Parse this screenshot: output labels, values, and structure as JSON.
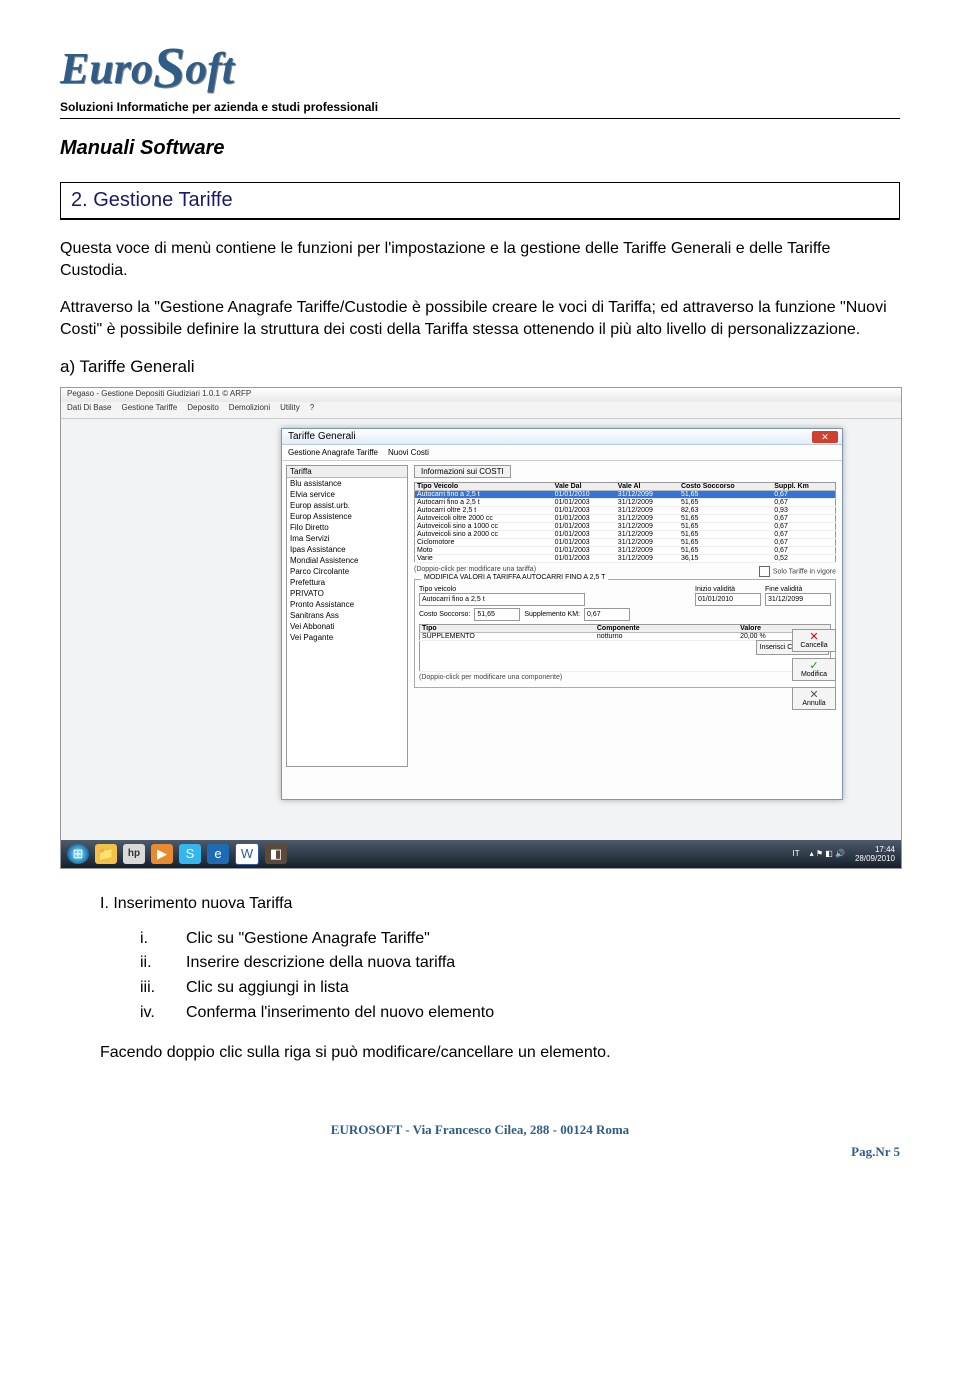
{
  "logo": {
    "part1": "Euro",
    "part2": "S",
    "part3": "oft"
  },
  "tagline": "Soluzioni Informatiche per azienda e studi professionali",
  "manual_title": "Manuali Software",
  "section_title": "2. Gestione Tariffe",
  "intro_p1": "Questa voce di menù contiene le funzioni per l'impostazione e la gestione delle Tariffe Generali e delle Tariffe Custodia.",
  "intro_p2": "Attraverso la \"Gestione Anagrafe Tariffe/Custodie è possibile creare le voci di Tariffa; ed attraverso la funzione \"Nuovi Costi\" è possibile definire la struttura dei costi della Tariffa stessa ottenendo il più alto livello di personalizzazione.",
  "subhead_a": "a) Tariffe Generali",
  "app": {
    "title": "Pegaso - Gestione Depositi Giudiziari 1.0.1 © ARFP",
    "menu": [
      "Dati Di Base",
      "Gestione Tariffe",
      "Deposito",
      "Demolizioni",
      "Utility",
      "?"
    ]
  },
  "dialog": {
    "title": "Tariffe Generali",
    "tabs": [
      "Gestione Anagrafe Tariffe",
      "Nuovi Costi"
    ],
    "list_header": "Tariffa",
    "tariffe": [
      "Blu assistance",
      "Elvia service",
      "Europ assist.urb.",
      "Europ Assistence",
      "Filo Diretto",
      "Ima Servizi",
      "Ipas Assistance",
      "Mondial Assistence",
      "Parco Circolante",
      "Prefettura",
      "PRIVATO",
      "Pronto Assistance",
      "Sanitrans Ass",
      "Vei Abbonati",
      "Vei Pagante"
    ],
    "info_btn": "Informazioni sui COSTI",
    "columns": [
      "Tipo Veicolo",
      "Vale Dal",
      "Vale Al",
      "Costo Soccorso",
      "Suppl. Km"
    ],
    "rows": [
      {
        "tv": "Autocarri fino a 2,5 t",
        "dal": "01/01/2010",
        "al": "31/12/2099",
        "cs": "51,65",
        "sk": "0,67",
        "sel": true
      },
      {
        "tv": "Autocarri fino a 2,5 t",
        "dal": "01/01/2003",
        "al": "31/12/2009",
        "cs": "51,65",
        "sk": "0,67"
      },
      {
        "tv": "Autocarri oltre 2,5 t",
        "dal": "01/01/2003",
        "al": "31/12/2009",
        "cs": "82,63",
        "sk": "0,93"
      },
      {
        "tv": "Autoveicoli oltre 2000 cc",
        "dal": "01/01/2003",
        "al": "31/12/2009",
        "cs": "51,65",
        "sk": "0,67"
      },
      {
        "tv": "Autoveicoli sino a 1000 cc",
        "dal": "01/01/2003",
        "al": "31/12/2009",
        "cs": "51,65",
        "sk": "0,67"
      },
      {
        "tv": "Autoveicoli sino a 2000 cc",
        "dal": "01/01/2003",
        "al": "31/12/2009",
        "cs": "51,65",
        "sk": "0,67"
      },
      {
        "tv": "Ciclomotore",
        "dal": "01/01/2003",
        "al": "31/12/2009",
        "cs": "51,65",
        "sk": "0,67"
      },
      {
        "tv": "Moto",
        "dal": "01/01/2003",
        "al": "31/12/2009",
        "cs": "51,65",
        "sk": "0,67"
      },
      {
        "tv": "Varie",
        "dal": "01/01/2003",
        "al": "31/12/2009",
        "cs": "36,15",
        "sk": "0,52"
      }
    ],
    "hint1": "(Doppio-click per modificare una tariffa)",
    "solo_vigore": "Solo Tariffe in vigore",
    "mod_legend": "MODIFICA VALORI A TARIFFA AUTOCARRI FINO A 2,5 T",
    "lbl_tipo_veicolo": "Tipo veicolo",
    "val_tipo_veicolo": "Autocarri fino a 2,5 t",
    "lbl_inizio": "Inizio validità",
    "val_inizio": "01/01/2010",
    "lbl_fine": "Fine validità",
    "val_fine": "31/12/2099",
    "lbl_costo": "Costo Soccorso:",
    "val_costo": "51,65",
    "lbl_suppkm": "Supplemento KM:",
    "val_suppkm": "0,67",
    "comp_cols": [
      "Tipo",
      "Componente",
      "Valore"
    ],
    "comp_row": {
      "tipo": "SUPPLEMENTO",
      "comp": "notturno",
      "val": "20,00 %"
    },
    "btn_ins_comp": "Inserisci Componenti",
    "hint2": "(Doppio-click per modificare una componente)",
    "btn_cancella": "Cancella",
    "btn_modifica": "Modifica",
    "btn_annulla": "Annulla"
  },
  "taskbar": {
    "lang": "IT",
    "time": "17:44",
    "date": "28/09/2010"
  },
  "list_I": "I.   Inserimento nuova Tariffa",
  "sublist": [
    {
      "n": "i.",
      "t": "Clic su \"Gestione Anagrafe Tariffe\""
    },
    {
      "n": "ii.",
      "t": "Inserire descrizione della nuova tariffa"
    },
    {
      "n": "iii.",
      "t": "Clic su aggiungi in lista"
    },
    {
      "n": "iv.",
      "t": "Conferma l'inserimento del nuovo elemento"
    }
  ],
  "closing": "Facendo doppio clic sulla riga si può modificare/cancellare un elemento.",
  "footer": "EUROSOFT  -  Via Francesco Cilea, 288  -  00124 Roma",
  "pagenr": "Pag.Nr 5"
}
